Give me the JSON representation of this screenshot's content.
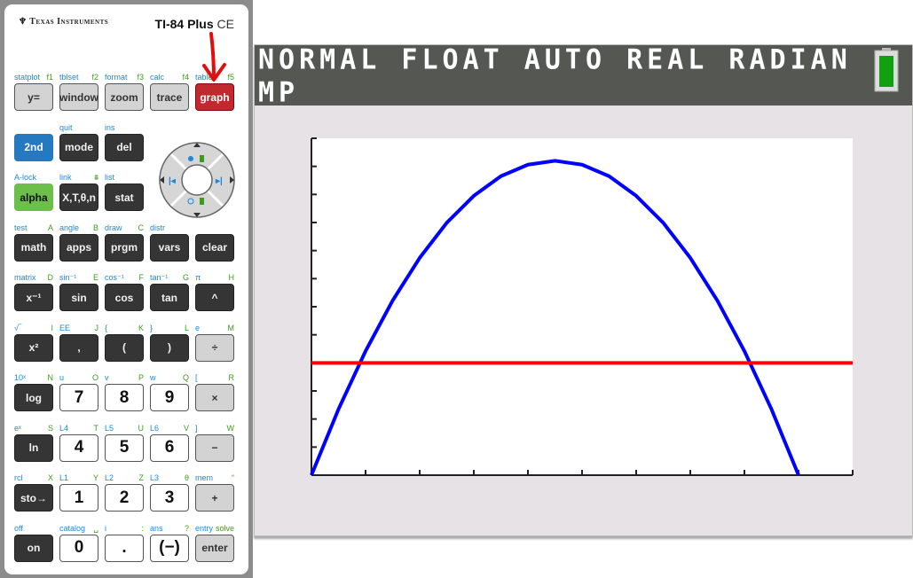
{
  "calculator": {
    "brand": "Texas Instruments",
    "model_main": "TI-84 Plus",
    "model_suffix": "CE",
    "rows": [
      [
        {
          "label": "y=",
          "shift": "statplot",
          "alpha": "f1",
          "style": "gray"
        },
        {
          "label": "window",
          "shift": "tblset",
          "alpha": "f2",
          "style": "gray"
        },
        {
          "label": "zoom",
          "shift": "format",
          "alpha": "f3",
          "style": "gray"
        },
        {
          "label": "trace",
          "shift": "calc",
          "alpha": "f4",
          "style": "gray"
        },
        {
          "label": "graph",
          "shift": "table",
          "alpha": "f5",
          "style": "red"
        }
      ],
      [
        {
          "label": "2nd",
          "shift": "",
          "alpha": "",
          "style": "blue"
        },
        {
          "label": "mode",
          "shift": "quit",
          "alpha": "",
          "style": "dark"
        },
        {
          "label": "del",
          "shift": "ins",
          "alpha": "",
          "style": "dark"
        }
      ],
      [
        {
          "label": "alpha",
          "shift": "A-lock",
          "alpha": "",
          "style": "green"
        },
        {
          "label": "X,T,θ,n",
          "shift": "link",
          "alpha": "⩩",
          "style": "dark"
        },
        {
          "label": "stat",
          "shift": "list",
          "alpha": "",
          "style": "dark"
        }
      ],
      [
        {
          "label": "math",
          "shift": "test",
          "alpha": "A",
          "style": "dark"
        },
        {
          "label": "apps",
          "shift": "angle",
          "alpha": "B",
          "style": "dark"
        },
        {
          "label": "prgm",
          "shift": "draw",
          "alpha": "C",
          "style": "dark"
        },
        {
          "label": "vars",
          "shift": "distr",
          "alpha": "",
          "style": "dark"
        },
        {
          "label": "clear",
          "shift": "",
          "alpha": "",
          "style": "dark"
        }
      ],
      [
        {
          "label": "x⁻¹",
          "shift": "matrix",
          "alpha": "D",
          "style": "dark"
        },
        {
          "label": "sin",
          "shift": "sin⁻¹",
          "alpha": "E",
          "style": "dark"
        },
        {
          "label": "cos",
          "shift": "cos⁻¹",
          "alpha": "F",
          "style": "dark"
        },
        {
          "label": "tan",
          "shift": "tan⁻¹",
          "alpha": "G",
          "style": "dark"
        },
        {
          "label": "^",
          "shift": "π",
          "alpha": "H",
          "style": "dark"
        }
      ],
      [
        {
          "label": "x²",
          "shift": "√‾",
          "alpha": "I",
          "style": "dark"
        },
        {
          "label": ",",
          "shift": "EE",
          "alpha": "J",
          "style": "dark"
        },
        {
          "label": "(",
          "shift": "{",
          "alpha": "K",
          "style": "dark"
        },
        {
          "label": ")",
          "shift": "}",
          "alpha": "L",
          "style": "dark"
        },
        {
          "label": "÷",
          "shift": "e",
          "alpha": "M",
          "style": "gray"
        }
      ],
      [
        {
          "label": "log",
          "shift": "10ˣ",
          "alpha": "N",
          "style": "dark"
        },
        {
          "label": "7",
          "shift": "u",
          "alpha": "O",
          "style": "white"
        },
        {
          "label": "8",
          "shift": "v",
          "alpha": "P",
          "style": "white"
        },
        {
          "label": "9",
          "shift": "w",
          "alpha": "Q",
          "style": "white"
        },
        {
          "label": "×",
          "shift": "[",
          "alpha": "R",
          "style": "gray"
        }
      ],
      [
        {
          "label": "ln",
          "shift": "eˣ",
          "alpha": "S",
          "style": "dark"
        },
        {
          "label": "4",
          "shift": "L4",
          "alpha": "T",
          "style": "white"
        },
        {
          "label": "5",
          "shift": "L5",
          "alpha": "U",
          "style": "white"
        },
        {
          "label": "6",
          "shift": "L6",
          "alpha": "V",
          "style": "white"
        },
        {
          "label": "−",
          "shift": "]",
          "alpha": "W",
          "style": "gray"
        }
      ],
      [
        {
          "label": "sto→",
          "shift": "rcl",
          "alpha": "X",
          "style": "dark"
        },
        {
          "label": "1",
          "shift": "L1",
          "alpha": "Y",
          "style": "white"
        },
        {
          "label": "2",
          "shift": "L2",
          "alpha": "Z",
          "style": "white"
        },
        {
          "label": "3",
          "shift": "L3",
          "alpha": "θ",
          "style": "white"
        },
        {
          "label": "+",
          "shift": "mem",
          "alpha": "“",
          "style": "gray"
        }
      ],
      [
        {
          "label": "on",
          "shift": "off",
          "alpha": "",
          "style": "dark"
        },
        {
          "label": "0",
          "shift": "catalog",
          "alpha": "␣",
          "style": "white"
        },
        {
          "label": ".",
          "shift": "i",
          "alpha": ":",
          "style": "white"
        },
        {
          "label": "(−)",
          "shift": "ans",
          "alpha": "?",
          "style": "white"
        },
        {
          "label": "enter",
          "shift": "entry",
          "alpha": "solve",
          "style": "gray"
        }
      ]
    ],
    "dpad": [
      "up",
      "down",
      "left",
      "right"
    ]
  },
  "screen": {
    "status_text": "NORMAL FLOAT AUTO REAL RADIAN MP",
    "battery_level": 1.0,
    "battery_color": "#10a010",
    "header_color": "#555753",
    "background_color": "#e6e2e6"
  },
  "annotation": {
    "type": "arrow",
    "points_to": "graph key",
    "color": "#e01010"
  },
  "chart_data": {
    "type": "line",
    "xlim": [
      0,
      10
    ],
    "ylim": [
      0,
      12
    ],
    "x_ticks": [
      0,
      1,
      2,
      3,
      4,
      5,
      6,
      7,
      8,
      9,
      10
    ],
    "y_ticks": [
      0,
      1,
      2,
      3,
      4,
      5,
      6,
      7,
      8,
      9,
      10,
      11,
      12
    ],
    "grid": false,
    "series": [
      {
        "color": "#0000ff",
        "x": [
          0,
          0.5,
          1,
          1.5,
          2,
          2.5,
          3,
          3.5,
          4,
          4.5,
          5,
          5.5,
          6,
          6.5,
          7,
          7.5,
          8,
          8.5,
          9
        ],
        "y": [
          0,
          2.35,
          4.42,
          6.22,
          7.74,
          8.99,
          9.95,
          10.65,
          11.06,
          11.2,
          11.06,
          10.65,
          9.95,
          8.99,
          7.74,
          6.22,
          4.42,
          2.35,
          0
        ]
      },
      {
        "color": "#ff0000",
        "x": [
          0,
          10
        ],
        "y": [
          4,
          4
        ]
      }
    ]
  }
}
